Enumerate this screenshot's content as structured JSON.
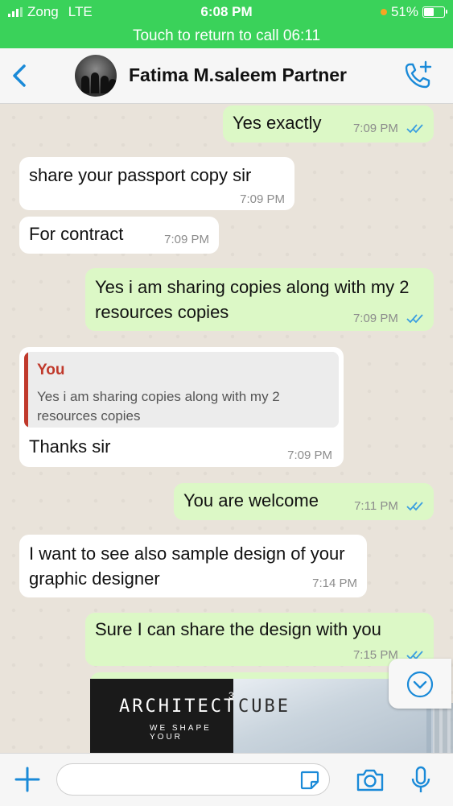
{
  "status_bar": {
    "carrier": "Zong",
    "network": "LTE",
    "time": "6:08 PM",
    "battery": "51%",
    "call_banner": "Touch to return to call 06:11"
  },
  "header": {
    "contact_name": "Fatima M.saleem Partner"
  },
  "messages": [
    {
      "text": "Yes exactly",
      "time": "7:09 PM"
    },
    {
      "text": "share your passport copy sir",
      "time": "7:09 PM"
    },
    {
      "text": "For contract",
      "time": "7:09 PM"
    },
    {
      "text": "Yes i am sharing copies along with my 2 resources copies",
      "time": "7:09 PM"
    },
    {
      "quote_author": "You",
      "quote_text": "Yes i am sharing copies along with my 2 resources copies",
      "text": "Thanks sir",
      "time": "7:09 PM"
    },
    {
      "text": "You are welcome",
      "time": "7:11 PM"
    },
    {
      "text": "I want to see also sample design of your graphic designer",
      "time": "7:14 PM"
    },
    {
      "text": "Sure I can share the design with you",
      "time": "7:15 PM"
    }
  ],
  "image_preview": {
    "brand": "ARCHITECTS",
    "superscript": "3",
    "brand2": "CUBE",
    "tagline": "WE SHAPE YOUR"
  },
  "colors": {
    "status_green": "#3ad25a",
    "outgoing_bubble": "#dcf8c6",
    "incoming_bubble": "#ffffff",
    "accent_blue": "#1a8ad8",
    "quote_red": "#c0392b"
  },
  "icons": [
    "back-icon",
    "add-call-icon",
    "read-ticks-icon",
    "scroll-down-icon",
    "plus-icon",
    "sticker-icon",
    "camera-icon",
    "mic-icon"
  ]
}
